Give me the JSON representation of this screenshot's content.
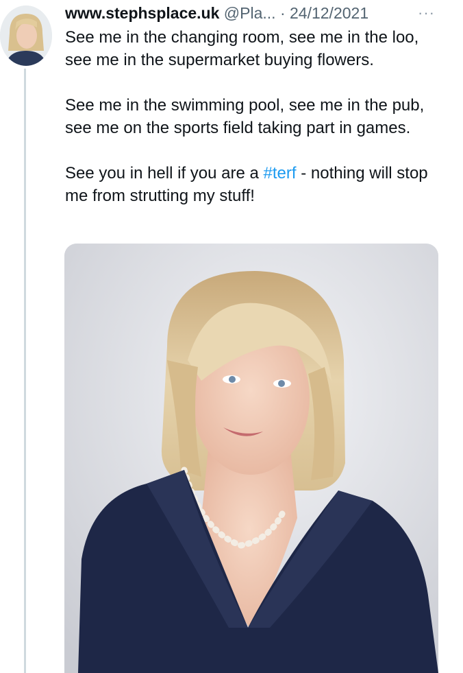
{
  "tweet": {
    "author_name": "www.stephsplace.uk",
    "handle": "@Pla...",
    "separator": "·",
    "date": "24/12/2021",
    "more_label": "···",
    "paragraphs": {
      "p1": "See me in the changing room, see me in the loo, see me in the supermarket buying flowers.",
      "p2": "See me in the swimming pool, see me in the pub, see me on the sports field taking part in games.",
      "p3_before": "See you in hell if you are a ",
      "p3_hashtag": "#terf",
      "p3_after": "  - nothing will stop me from strutting my stuff!"
    }
  },
  "icons": {
    "more": "more-horizontal-icon"
  },
  "colors": {
    "text": "#0f1419",
    "secondary": "#536471",
    "link": "#1d9bf0",
    "thread_line": "#cfd9de"
  }
}
